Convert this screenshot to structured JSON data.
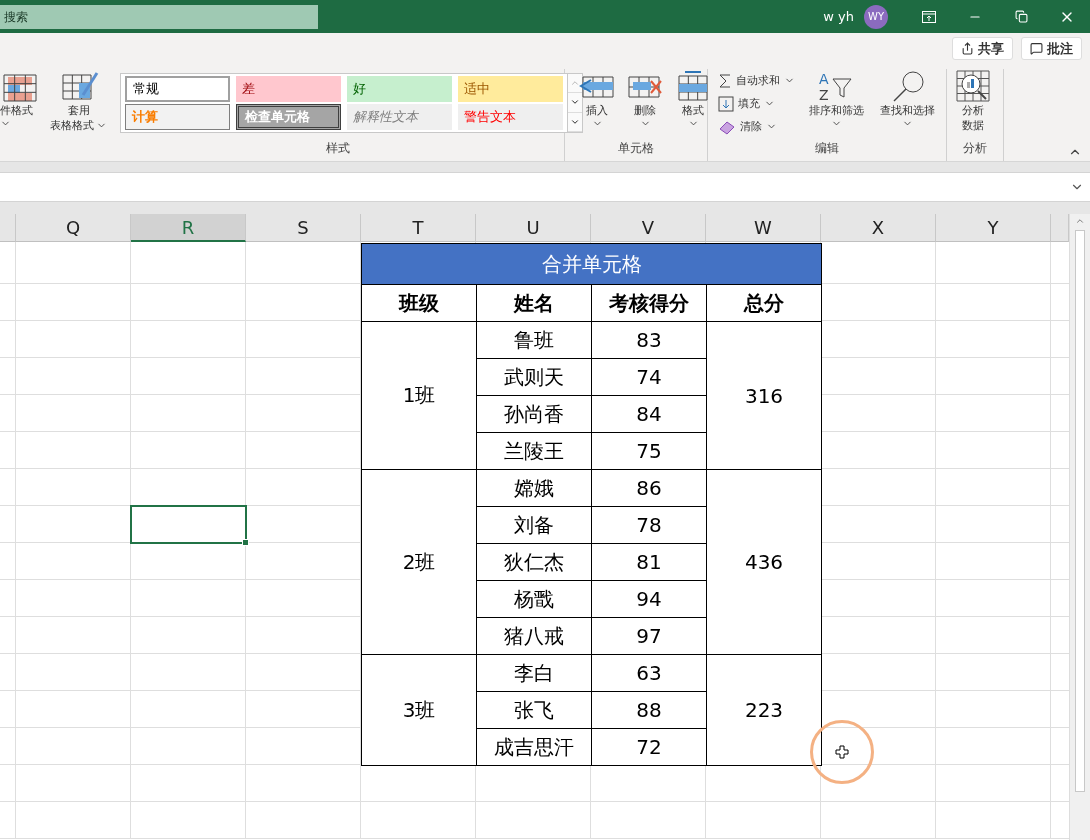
{
  "title_bar": {
    "search_placeholder": "搜索",
    "user_name": "w yh",
    "avatar": "WY"
  },
  "ribbon": {
    "top_buttons": [
      {
        "kind": "share",
        "label": "共享"
      },
      {
        "kind": "comment",
        "label": "批注"
      }
    ],
    "partial_group": {
      "buttons": [
        {
          "kind": "conditional",
          "label": "件格式"
        },
        {
          "kind": "table",
          "label": "套用",
          "label2": "表格格式"
        }
      ]
    },
    "styles_group": {
      "label": "样式",
      "styles": [
        {
          "kind": "normal",
          "label": "常规"
        },
        {
          "kind": "bad",
          "label": "差"
        },
        {
          "kind": "good",
          "label": "好"
        },
        {
          "kind": "neutral",
          "label": "适中"
        },
        {
          "kind": "calc",
          "label": "计算"
        },
        {
          "kind": "check",
          "label": "检查单元格"
        },
        {
          "kind": "explain",
          "label": "解释性文本"
        },
        {
          "kind": "warn",
          "label": "警告文本"
        }
      ]
    },
    "cells_group": {
      "label": "单元格",
      "buttons": [
        {
          "kind": "insert",
          "label": "插入"
        },
        {
          "kind": "delete",
          "label": "删除"
        },
        {
          "kind": "format",
          "label": "格式"
        }
      ]
    },
    "edit_group": {
      "label": "编辑",
      "small_buttons": [
        {
          "kind": "sum",
          "label": "自动求和"
        },
        {
          "kind": "fill",
          "label": "填充"
        },
        {
          "kind": "clear",
          "label": "清除"
        }
      ],
      "large_buttons": [
        {
          "kind": "sort",
          "label": "排序和筛选",
          "icon_letters": [
            "A",
            "Z"
          ]
        },
        {
          "kind": "find",
          "label": "查找和选择"
        }
      ]
    },
    "analysis_group": {
      "label": "分析",
      "button_lines": [
        "分析",
        "数据"
      ]
    }
  },
  "columns": [
    {
      "label": "Q",
      "selected": false
    },
    {
      "label": "R",
      "selected": true
    },
    {
      "label": "S",
      "selected": false
    },
    {
      "label": "T",
      "selected": false
    },
    {
      "label": "U",
      "selected": false
    },
    {
      "label": "V",
      "selected": false
    },
    {
      "label": "W",
      "selected": false
    },
    {
      "label": "X",
      "selected": false
    },
    {
      "label": "Y",
      "selected": false
    }
  ],
  "table": {
    "title": "合并单元格",
    "headers": [
      "班级",
      "姓名",
      "考核得分",
      "总分"
    ],
    "groups": [
      {
        "class": "1班",
        "total": "316",
        "members": [
          {
            "name": "鲁班",
            "score": "83"
          },
          {
            "name": "武则天",
            "score": "74"
          },
          {
            "name": "孙尚香",
            "score": "84"
          },
          {
            "name": "兰陵王",
            "score": "75"
          }
        ]
      },
      {
        "class": "2班",
        "total": "436",
        "members": [
          {
            "name": "嫦娥",
            "score": "86"
          },
          {
            "name": "刘备",
            "score": "78"
          },
          {
            "name": "狄仁杰",
            "score": "81"
          },
          {
            "name": "杨戬",
            "score": "94"
          },
          {
            "name": "猪八戒",
            "score": "97"
          }
        ]
      },
      {
        "class": "3班",
        "total": "223",
        "members": [
          {
            "name": "李白",
            "score": "63"
          },
          {
            "name": "张飞",
            "score": "88"
          },
          {
            "name": "成吉思汗",
            "score": "72"
          }
        ]
      }
    ]
  }
}
